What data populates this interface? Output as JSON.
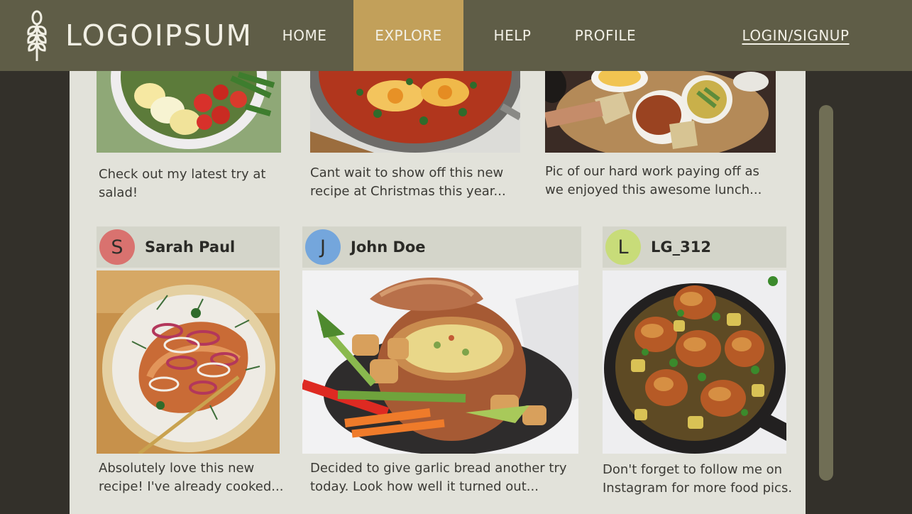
{
  "nav": {
    "logo_text": "LOGOIPSUM",
    "items": [
      {
        "label": "HOME"
      },
      {
        "label": "EXPLORE"
      },
      {
        "label": "HELP"
      },
      {
        "label": "PROFILE"
      }
    ],
    "login_label": "LOGIN/SIGNUP",
    "accent_color": "#c2a05a",
    "bar_color": "#5f5d47"
  },
  "feed": {
    "top_captions": [
      "Check out my latest try at\nsalad!",
      "Cant wait to show off this new\nrecipe at Christmas this year...",
      "Pic of our hard work paying off as\nwe enjoyed this awesome lunch..."
    ],
    "posts": [
      {
        "initial": "S",
        "user": "Sarah Paul",
        "avatar_color": "#d9726f",
        "caption": "Absolutely love this new\nrecipe! I've already cooked..."
      },
      {
        "initial": "J",
        "user": "John Doe",
        "avatar_color": "#74a6dc",
        "caption": "Decided to give garlic bread another try\ntoday. Look how well it turned out..."
      },
      {
        "initial": "L",
        "user": "LG_312",
        "avatar_color": "#c8dc79",
        "caption": "Don't forget to follow me on\nInstagram for more food pics."
      }
    ]
  }
}
